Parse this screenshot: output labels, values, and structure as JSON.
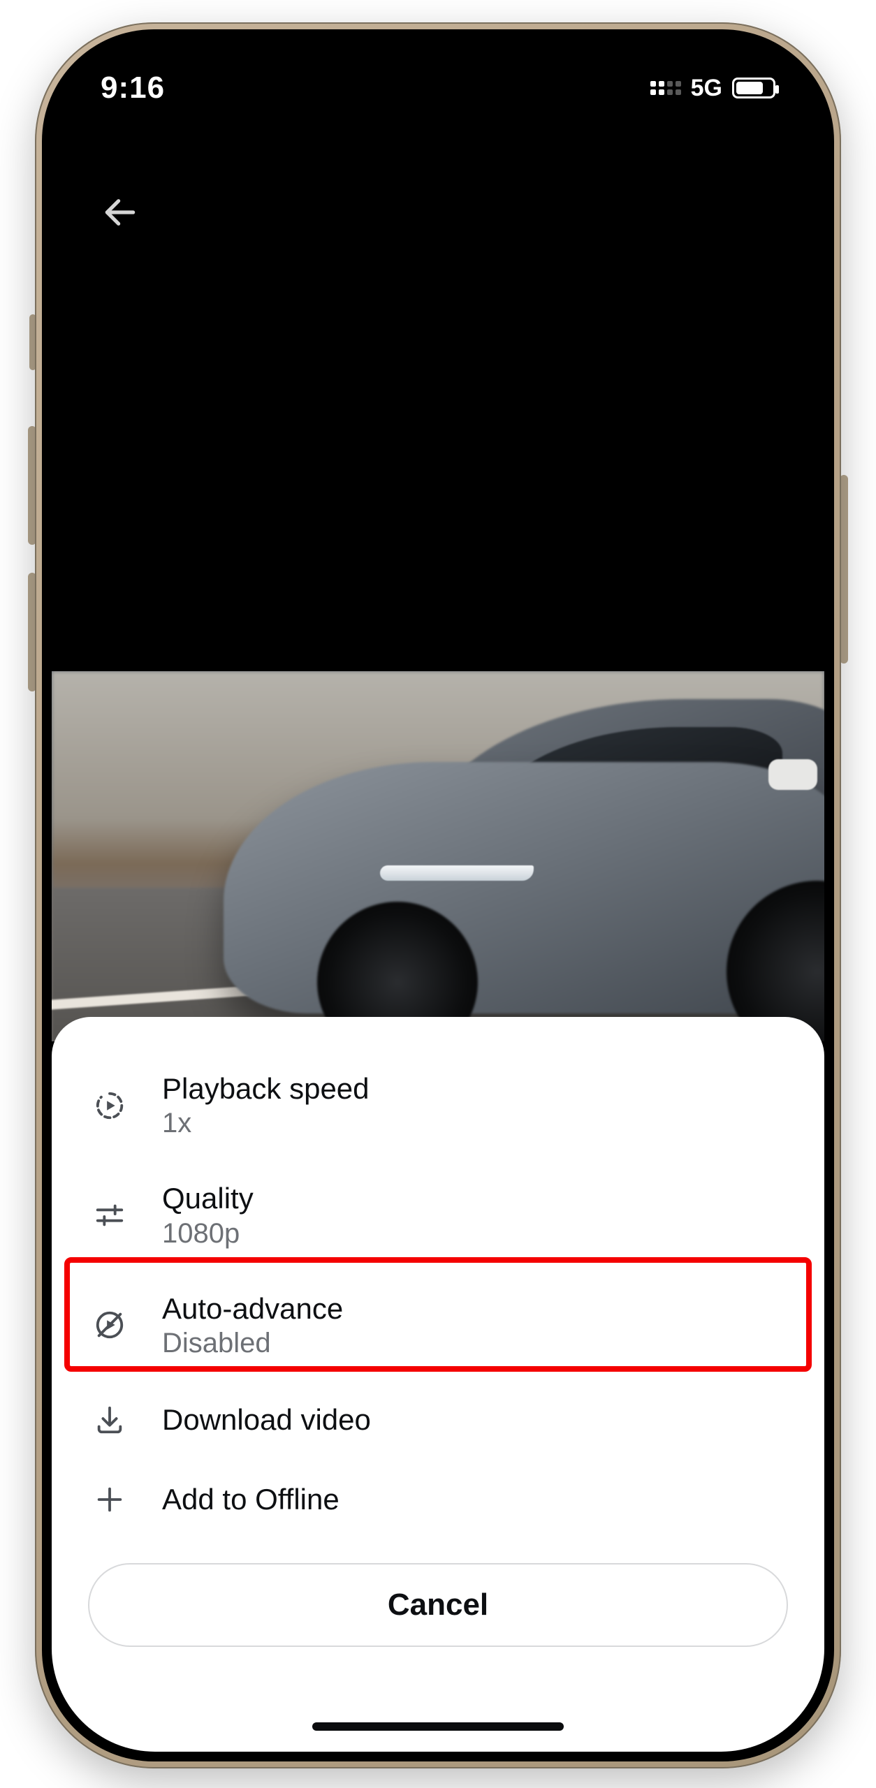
{
  "status": {
    "time": "9:16",
    "network": "5G"
  },
  "sheet": {
    "playback_speed": {
      "label": "Playback speed",
      "value": "1x"
    },
    "quality": {
      "label": "Quality",
      "value": "1080p"
    },
    "auto_advance": {
      "label": "Auto-advance",
      "value": "Disabled"
    },
    "download": {
      "label": "Download video"
    },
    "add_offline": {
      "label": "Add to Offline"
    },
    "cancel": {
      "label": "Cancel"
    }
  }
}
